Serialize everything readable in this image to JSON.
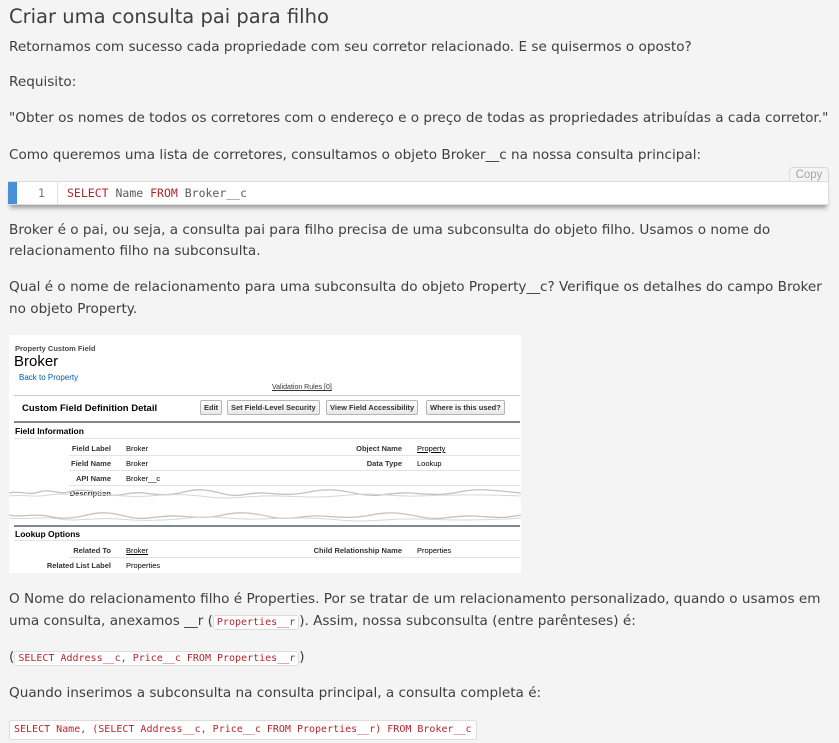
{
  "page": {
    "title": "Criar uma consulta pai para filho",
    "para1": "Retornamos com sucesso cada propriedade com seu corretor relacionado. E se quisermos o oposto?",
    "para2": "Requisito:",
    "para3": "\"Obter os nomes de todos os corretores com o endereço e o preço de todas as propriedades atribuídas a cada corretor.\"",
    "para4": "Como queremos uma lista de corretores, consultamos o objeto Broker__c na nossa consulta principal:",
    "para5_line1": "Broker é o pai, ou seja, a consulta pai para filho precisa de uma subconsulta do objeto filho. Usamos o nome do",
    "para5_line2": "relacionamento filho na subconsulta.",
    "para6_line1": "Qual é o nome de relacionamento para uma subconsulta do objeto Property__c? Verifique os detalhes do campo Broker",
    "para6_line2": "no objeto Property.",
    "para7_line1": "O Nome do relacionamento filho é Properties. Por se tratar de um relacionamento personalizado, quando o usamos em",
    "para7_line2_pre": "uma consulta, anexamos __r (",
    "para7_line2_code": "Properties__r",
    "para7_line2_post": "). Assim, nossa subconsulta (entre parênteses) é:",
    "subquery_open": "(",
    "subquery_code": "SELECT Address__c, Price__c FROM Properties__r",
    "subquery_close": ")",
    "para8": "Quando inserimos a subconsulta na consulta principal, a consulta completa é:"
  },
  "code_block": {
    "line_number": "1",
    "kw_select": "SELECT",
    "field": " Name ",
    "kw_from": "FROM",
    "object": " Broker__c",
    "copy_label": "Copy"
  },
  "final_query": {
    "part1": "SELECT Name, (SELECT Address__c, Price__c FROM Properties__r) ",
    "part2": "FROM Broker__c"
  },
  "sf_screenshot": {
    "object_label": "Property Custom Field",
    "field_title": "Broker",
    "back_link": "Back to Property",
    "validation_link": "Validation Rules [0]",
    "section_title": "Custom Field Definition Detail",
    "buttons": {
      "edit": "Edit",
      "fls": "Set Field-Level Security",
      "accessibility": "View Field Accessibility",
      "where_used": "Where is this used?"
    },
    "field_info_heading": "Field Information",
    "field_label_lbl": "Field Label",
    "field_label_val": "Broker",
    "object_name_lbl": "Object Name",
    "object_name_val": "Property",
    "field_name_lbl": "Field Name",
    "field_name_val": "Broker",
    "data_type_lbl": "Data Type",
    "data_type_val": "Lookup",
    "api_name_lbl": "API Name",
    "api_name_val": "Broker__c",
    "description_lbl": "Description",
    "lookup_heading": "Lookup Options",
    "related_to_lbl": "Related To",
    "related_to_val": "Broker",
    "child_rel_lbl": "Child Relationship Name",
    "child_rel_val": "Properties",
    "related_list_lbl": "Related List Label",
    "related_list_val": "Properties"
  }
}
